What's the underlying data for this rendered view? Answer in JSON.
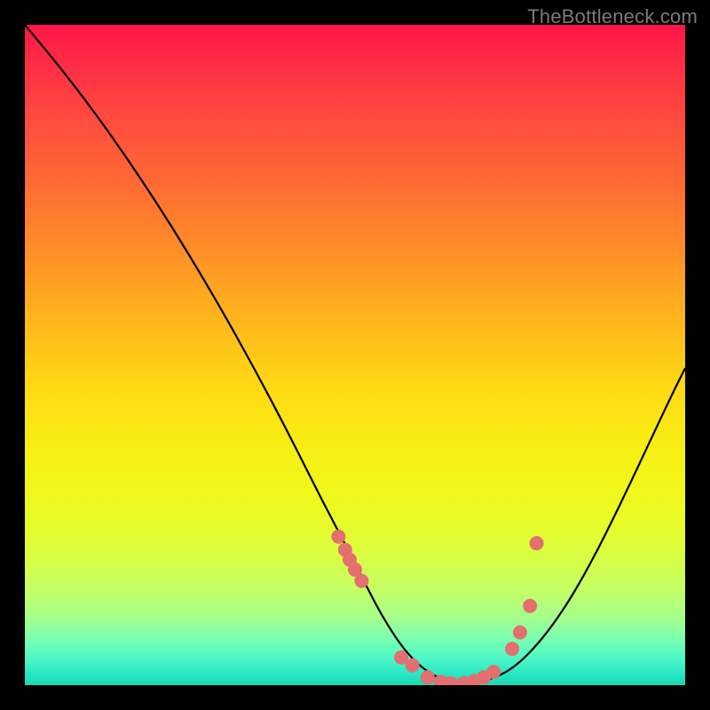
{
  "watermark": "TheBottleneck.com",
  "chart_data": {
    "type": "line",
    "title": "",
    "xlabel": "",
    "ylabel": "",
    "xlim": [
      0,
      100
    ],
    "ylim": [
      0,
      100
    ],
    "curve": {
      "x": [
        0,
        5,
        10,
        15,
        20,
        25,
        30,
        35,
        40,
        45,
        50,
        54,
        58,
        62,
        66,
        70,
        74,
        78,
        82,
        86,
        90,
        94,
        98,
        100
      ],
      "y": [
        100,
        94,
        87.5,
        80.5,
        73,
        65,
        56.5,
        47.5,
        38,
        28,
        18.5,
        10.5,
        4.5,
        1.2,
        0.2,
        0.6,
        2.5,
        6.5,
        12,
        19,
        27,
        35.5,
        44,
        48
      ]
    },
    "scatter": {
      "x": [
        47.5,
        48.5,
        49.2,
        50.0,
        51.0,
        57.0,
        58.7,
        61.0,
        63.0,
        64.5,
        66.5,
        68.0,
        69.5,
        71.0,
        73.8,
        75.0,
        76.5,
        77.5
      ],
      "y": [
        22.5,
        20.5,
        19.0,
        17.5,
        15.8,
        4.2,
        3.0,
        1.2,
        0.5,
        0.3,
        0.3,
        0.6,
        1.2,
        2.0,
        5.5,
        8.0,
        12.0,
        21.5
      ]
    },
    "scatter_color": "#e36f6f",
    "curve_color": "#000000"
  }
}
